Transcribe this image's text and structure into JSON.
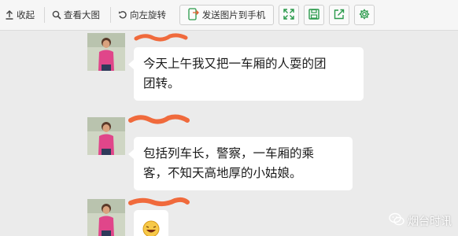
{
  "toolbar": {
    "collapse_label": "收起",
    "view_large_label": "查看大图",
    "rotate_left_label": "向左旋转",
    "send_to_phone_label": "发送图片到手机",
    "icons": {
      "collapse": "arrow-up-icon",
      "view_large": "magnifier-icon",
      "rotate_left": "rotate-left-icon",
      "send_to_phone": "phone-send-icon",
      "fullscreen": "expand-icon",
      "save": "floppy-save-icon",
      "share": "share-icon",
      "settings": "gear-icon"
    },
    "accent_color": "#2a9a4b"
  },
  "chat": {
    "messages": [
      {
        "lines": [
          "今天上午我又把一车厢的人耍的团",
          "团转。"
        ]
      },
      {
        "lines": [
          "包括列车长，警察，一车厢的乘",
          "客，不知天高地厚的小姑娘。"
        ]
      },
      {
        "emoji": "laughing-emoji"
      }
    ],
    "name_redaction_color": "#f06a3c"
  },
  "watermark": {
    "text": "烟台时讯",
    "icon": "wechat-icon"
  }
}
